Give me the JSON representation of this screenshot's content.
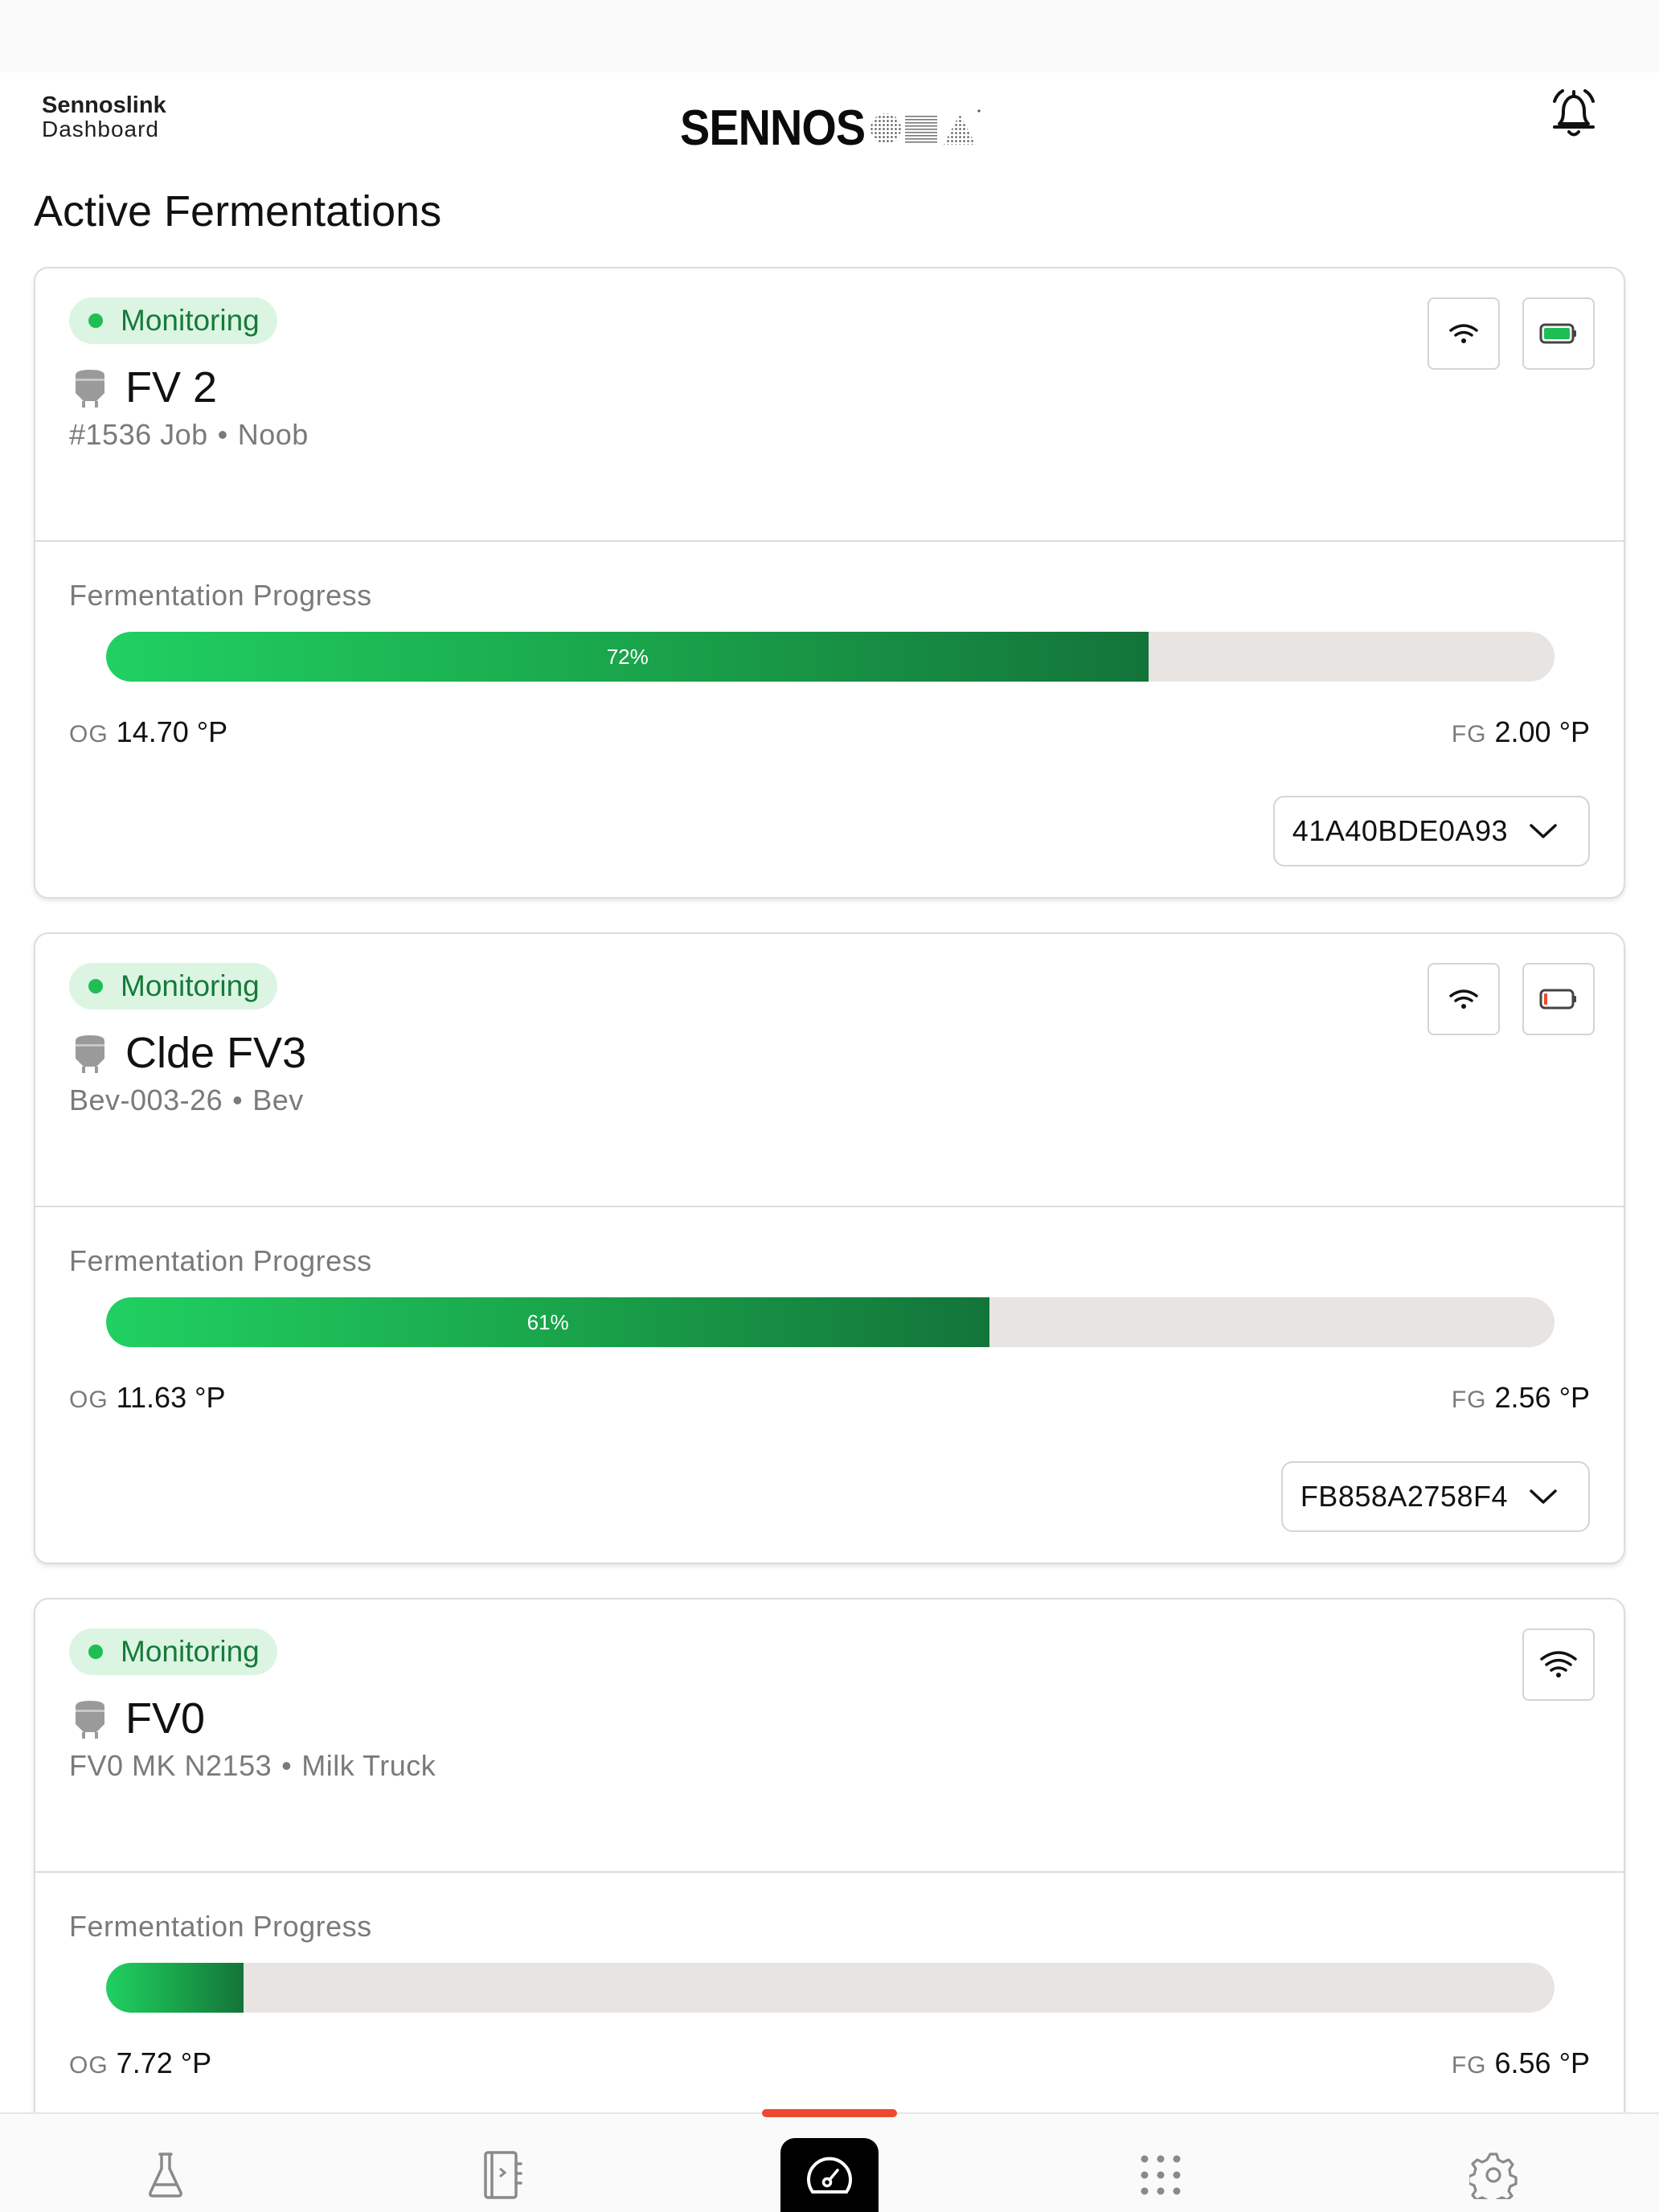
{
  "header": {
    "app_name": "Sennoslink",
    "app_subtitle": "Dashboard",
    "logo_text": "SENNOS",
    "bell_icon": "bell-icon"
  },
  "page_title": "Active Fermentations",
  "colors": {
    "accent": "#ee4a2e",
    "status_green": "#1fbe55",
    "status_pill_bg": "#dcf5e3",
    "progress_start": "#20d062",
    "progress_end": "#13743a",
    "progress_track": "#e7e4e1"
  },
  "fermentations": [
    {
      "status": "Monitoring",
      "name": "FV 2",
      "batch": "#1536 Job",
      "beer": "Noob",
      "separator": "•",
      "progress_label": "Fermentation Progress",
      "progress": 0.72,
      "progress_text": "72%",
      "og_label": "OG",
      "og_value": "14.70 °P",
      "fg_label": "FG",
      "fg_value": "2.00 °P",
      "device_id": "41A40BDE0A93",
      "battery": "full"
    },
    {
      "status": "Monitoring",
      "name": "Clde FV3",
      "batch": "Bev-003-26",
      "beer": "Bev",
      "separator": "•",
      "progress_label": "Fermentation Progress",
      "progress": 0.61,
      "progress_text": "61%",
      "og_label": "OG",
      "og_value": "11.63 °P",
      "fg_label": "FG",
      "fg_value": "2.56 °P",
      "device_id": "FB858A2758F4",
      "battery": "low"
    },
    {
      "status": "Monitoring",
      "name": "FV0",
      "batch": "FV0 MK N2153",
      "beer": "Milk Truck",
      "separator": "•",
      "progress_label": "Fermentation Progress",
      "progress": 0.095,
      "progress_text": "",
      "og_label": "OG",
      "og_value": "7.72 °P",
      "fg_label": "FG",
      "fg_value": "6.56 °P"
    }
  ],
  "tabbar": {
    "active": "dashboard",
    "tabs": [
      "flask-icon",
      "recipe-book-icon",
      "dashboard-gauge-icon",
      "apps-grid-icon",
      "settings-gear-icon"
    ]
  }
}
